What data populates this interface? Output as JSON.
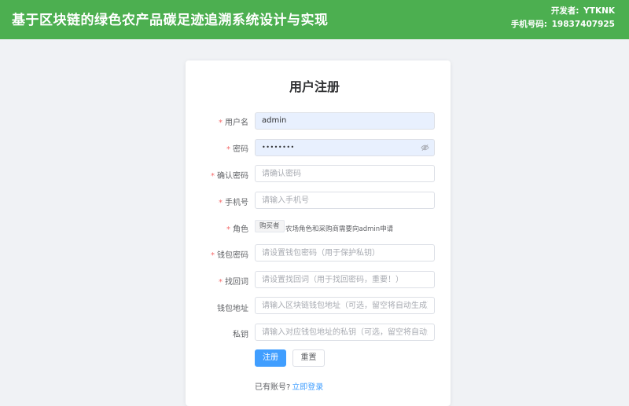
{
  "header": {
    "title": "基于区块链的绿色农产品碳足迹追溯系统设计与实现",
    "developer_label": "开发者:",
    "developer_name": "YTKNK",
    "phone_label": "手机号码:",
    "phone_value": "19837407925"
  },
  "form": {
    "title": "用户注册",
    "username": {
      "label": "用户名",
      "required": true,
      "value": "admin"
    },
    "password": {
      "label": "密码",
      "required": true,
      "value": "••••••••"
    },
    "confirm_password": {
      "label": "确认密码",
      "required": true,
      "placeholder": "请确认密码"
    },
    "phone": {
      "label": "手机号",
      "required": true,
      "placeholder": "请输入手机号"
    },
    "role": {
      "label": "角色",
      "required": true,
      "tag": "购买者",
      "hint": "农场角色和采购商需要向admin申请"
    },
    "wallet_password": {
      "label": "钱包密码",
      "required": true,
      "placeholder": "请设置钱包密码（用于保护私钥）"
    },
    "recovery_phrase": {
      "label": "找回词",
      "required": true,
      "placeholder": "请设置找回词（用于找回密码，重要！）"
    },
    "wallet_address": {
      "label": "钱包地址",
      "required": false,
      "placeholder": "请输入区块链钱包地址（可选，留空将自动生成）"
    },
    "private_key": {
      "label": "私钥",
      "required": false,
      "placeholder": "请输入对应钱包地址的私钥（可选，留空将自动生成）"
    },
    "register_button": "注册",
    "reset_button": "重置",
    "have_account_text": "已有账号?",
    "login_link": "立即登录"
  },
  "colors": {
    "header_bg": "#4caf50",
    "primary": "#409eff",
    "required": "#f56c6c",
    "autofill_bg": "#e8f0fe"
  },
  "icons": {
    "password_toggle": "eye-off-icon"
  }
}
